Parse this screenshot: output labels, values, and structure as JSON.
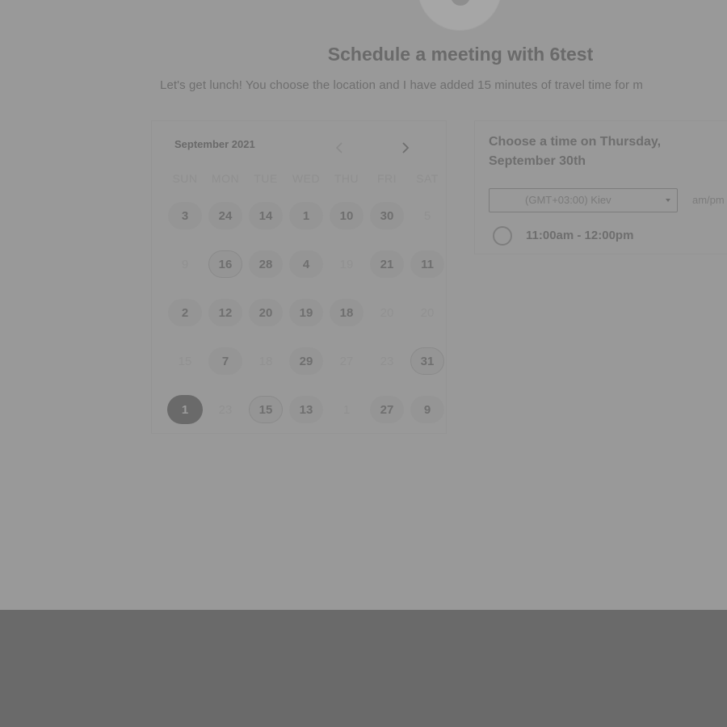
{
  "header": {
    "title": "Schedule a meeting with 6test",
    "subtitle": "Let's get lunch! You choose the location and I have added 15 minutes of travel time for m"
  },
  "calendar": {
    "month_label": "September 2021",
    "prev_icon": "chevron-left-icon",
    "next_icon": "chevron-right-icon",
    "weekdays": [
      "SUN",
      "MON",
      "TUE",
      "WED",
      "THU",
      "FRI",
      "SAT"
    ],
    "weeks": [
      [
        {
          "d": "3",
          "s": "avail"
        },
        {
          "d": "24",
          "s": "avail"
        },
        {
          "d": "14",
          "s": "avail"
        },
        {
          "d": "1",
          "s": "avail"
        },
        {
          "d": "10",
          "s": "avail"
        },
        {
          "d": "30",
          "s": "avail"
        },
        {
          "d": "5",
          "s": "muted"
        }
      ],
      [
        {
          "d": "9",
          "s": "muted"
        },
        {
          "d": "16",
          "s": "outline"
        },
        {
          "d": "28",
          "s": "avail"
        },
        {
          "d": "4",
          "s": "avail"
        },
        {
          "d": "19",
          "s": "muted"
        },
        {
          "d": "21",
          "s": "avail"
        },
        {
          "d": "11",
          "s": "avail"
        }
      ],
      [
        {
          "d": "2",
          "s": "avail"
        },
        {
          "d": "12",
          "s": "avail"
        },
        {
          "d": "20",
          "s": "avail"
        },
        {
          "d": "19",
          "s": "avail"
        },
        {
          "d": "18",
          "s": "avail"
        },
        {
          "d": "20",
          "s": "muted"
        },
        {
          "d": "20",
          "s": "muted"
        }
      ],
      [
        {
          "d": "15",
          "s": "muted"
        },
        {
          "d": "7",
          "s": "avail"
        },
        {
          "d": "18",
          "s": "muted"
        },
        {
          "d": "29",
          "s": "avail"
        },
        {
          "d": "27",
          "s": "muted"
        },
        {
          "d": "23",
          "s": "muted"
        },
        {
          "d": "31",
          "s": "outline"
        }
      ],
      [
        {
          "d": "1",
          "s": "selected"
        },
        {
          "d": "23",
          "s": "muted"
        },
        {
          "d": "15",
          "s": "outline"
        },
        {
          "d": "13",
          "s": "avail"
        },
        {
          "d": "1",
          "s": "muted"
        },
        {
          "d": "27",
          "s": "avail"
        },
        {
          "d": "9",
          "s": "avail"
        }
      ]
    ]
  },
  "times": {
    "heading": "Choose a time on Thursday, September 30th",
    "timezone": "(GMT+03:00) Kiev",
    "format_toggle": "am/pm",
    "slots": [
      {
        "label": "11:00am - 12:00pm"
      }
    ]
  },
  "colors": {
    "overlay_page": "#999999",
    "overlay_footer": "#6a6a6a",
    "selected_day": "#6a6a6a"
  }
}
